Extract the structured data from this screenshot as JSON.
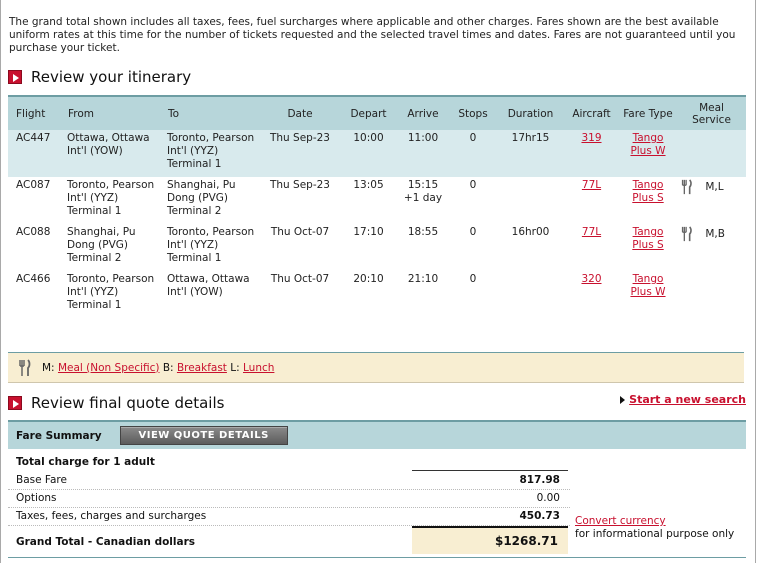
{
  "intro_text": "The grand total shown includes all taxes, fees, fuel surcharges where applicable and other charges. Fares shown are the best available uniform rates at this time for the number of tickets requested and the selected travel times and dates. Fares are not guaranteed until you purchase your ticket.",
  "itinerary": {
    "title": "Review your itinerary",
    "headers": {
      "flight": "Flight",
      "from": "From",
      "to": "To",
      "date": "Date",
      "depart": "Depart",
      "arrive": "Arrive",
      "stops": "Stops",
      "duration": "Duration",
      "aircraft": "Aircraft",
      "fare_type": "Fare Type",
      "meal_service": "Meal Service"
    },
    "rows": [
      {
        "flight": "AC447",
        "from": "Ottawa, Ottawa Int'l (YOW)",
        "to": "Toronto, Pearson Int'l (YYZ) Terminal 1",
        "date": "Thu Sep-23",
        "depart": "10:00",
        "arrive": "11:00",
        "stops": "0",
        "duration": "17hr15",
        "aircraft": "319",
        "fare_type": "Tango Plus W",
        "meal": ""
      },
      {
        "flight": "AC087",
        "from": "Toronto, Pearson Int'l (YYZ) Terminal 1",
        "to": "Shanghai, Pu Dong (PVG) Terminal 2",
        "date": "Thu Sep-23",
        "depart": "13:05",
        "arrive": "15:15 +1 day",
        "stops": "0",
        "duration": "",
        "aircraft": "77L",
        "fare_type": "Tango Plus S",
        "meal": "M,L"
      },
      {
        "flight": "AC088",
        "from": "Shanghai, Pu Dong (PVG) Terminal 2",
        "to": "Toronto, Pearson Int'l (YYZ) Terminal 1",
        "date": "Thu Oct-07",
        "depart": "17:10",
        "arrive": "18:55",
        "stops": "0",
        "duration": "16hr00",
        "aircraft": "77L",
        "fare_type": "Tango Plus S",
        "meal": "M,B"
      },
      {
        "flight": "AC466",
        "from": "Toronto, Pearson Int'l (YYZ) Terminal 1",
        "to": "Ottawa, Ottawa Int'l (YOW)",
        "date": "Thu Oct-07",
        "depart": "20:10",
        "arrive": "21:10",
        "stops": "0",
        "duration": "",
        "aircraft": "320",
        "fare_type": "Tango Plus W",
        "meal": ""
      }
    ]
  },
  "legend": {
    "m_prefix": "M:",
    "m_link": "Meal (Non Specific)",
    "b_prefix": "B:",
    "b_link": "Breakfast",
    "l_prefix": "L:",
    "l_link": "Lunch"
  },
  "quote": {
    "title": "Review final quote details",
    "new_search": "Start a new search",
    "fare_summary_label": "Fare Summary",
    "view_quote_button": "VIEW QUOTE DETAILS",
    "total_charge_label": "Total charge for 1 adult",
    "base_fare_label": "Base Fare",
    "base_fare_value": "817.98",
    "options_label": "Options",
    "options_value": "0.00",
    "taxes_label": "Taxes, fees, charges and surcharges",
    "taxes_value": "450.73",
    "grand_total_label": "Grand Total - Canadian dollars",
    "grand_total_value": "$1268.71",
    "convert_link": "Convert currency",
    "convert_note": "for informational purpose only"
  },
  "colors": {
    "accent_red": "#c8102e",
    "header_teal": "#b7d6da",
    "row_teal": "#d8eaed",
    "cream": "#f8eed2"
  }
}
